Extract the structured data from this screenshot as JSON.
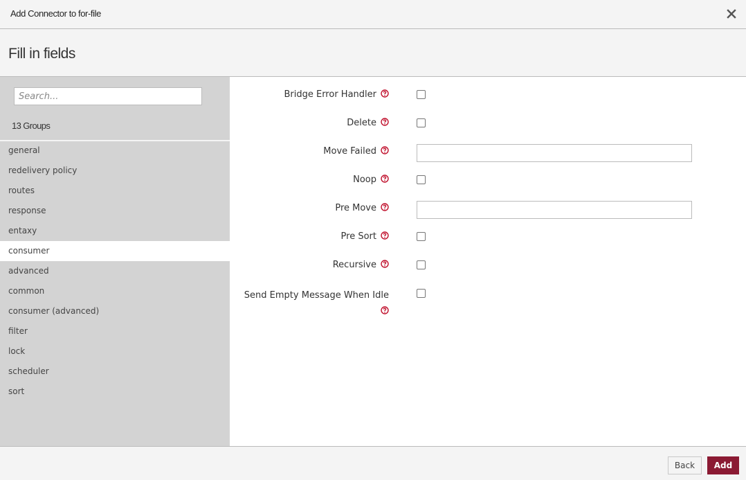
{
  "header": {
    "title": "Add Connector to for-file",
    "close_icon": "close-icon"
  },
  "subheader": {
    "title": "Fill in fields"
  },
  "sidebar": {
    "search": {
      "placeholder": "Search...",
      "value": ""
    },
    "groups_count": "13 Groups",
    "active_group": "consumer",
    "groups": [
      {
        "label": "general"
      },
      {
        "label": "redelivery policy"
      },
      {
        "label": "routes"
      },
      {
        "label": "response"
      },
      {
        "label": "entaxy"
      },
      {
        "label": "consumer"
      },
      {
        "label": "advanced"
      },
      {
        "label": "common"
      },
      {
        "label": "consumer (advanced)"
      },
      {
        "label": "filter"
      },
      {
        "label": "lock"
      },
      {
        "label": "scheduler"
      },
      {
        "label": "sort"
      }
    ]
  },
  "form": {
    "help_icon": "help-circle-icon",
    "fields": [
      {
        "label": "Bridge Error Handler",
        "type": "checkbox",
        "checked": false
      },
      {
        "label": "Delete",
        "type": "checkbox",
        "checked": false
      },
      {
        "label": "Move Failed",
        "type": "text",
        "value": ""
      },
      {
        "label": "Noop",
        "type": "checkbox",
        "checked": false
      },
      {
        "label": "Pre Move",
        "type": "text",
        "value": ""
      },
      {
        "label": "Pre Sort",
        "type": "checkbox",
        "checked": false
      },
      {
        "label": "Recursive",
        "type": "checkbox",
        "checked": false
      },
      {
        "label": "Send Empty Message When Idle",
        "type": "checkbox",
        "checked": false
      }
    ]
  },
  "footer": {
    "back_label": "Back",
    "add_label": "Add"
  },
  "colors": {
    "accent": "#8b1a33",
    "help_icon": "#c0102c",
    "sidebar_bg": "#d3d3d3",
    "header_bg": "#f4f4f4"
  }
}
